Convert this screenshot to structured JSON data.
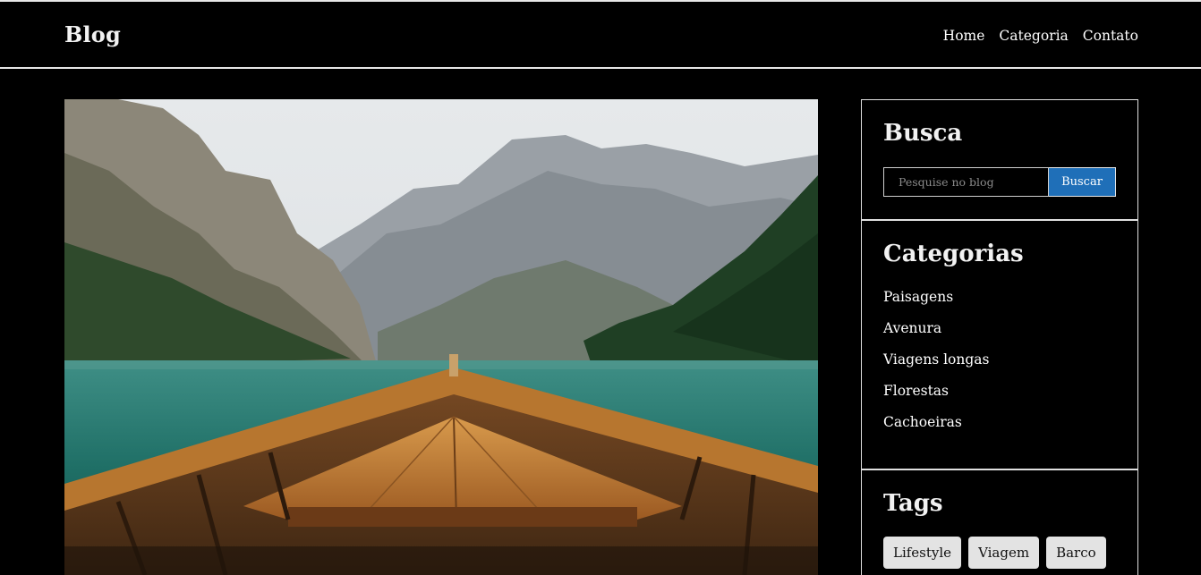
{
  "header": {
    "brand": "Blog",
    "nav": [
      "Home",
      "Categoria",
      "Contato"
    ]
  },
  "hero": {
    "alt_icon": "mountain-lake-boat-photo"
  },
  "sidebar": {
    "search": {
      "title": "Busca",
      "placeholder": "Pesquise no blog",
      "button": "Buscar"
    },
    "categories": {
      "title": "Categorias",
      "items": [
        "Paisagens",
        "Avenura",
        "Viagens longas",
        "Florestas",
        "Cachoeiras"
      ]
    },
    "tags": {
      "title": "Tags",
      "items": [
        "Lifestyle",
        "Viagem",
        "Barco"
      ]
    }
  },
  "colors": {
    "background": "#000000",
    "accent": "#1f6fb8",
    "tag_bg": "#e3e3e3"
  }
}
